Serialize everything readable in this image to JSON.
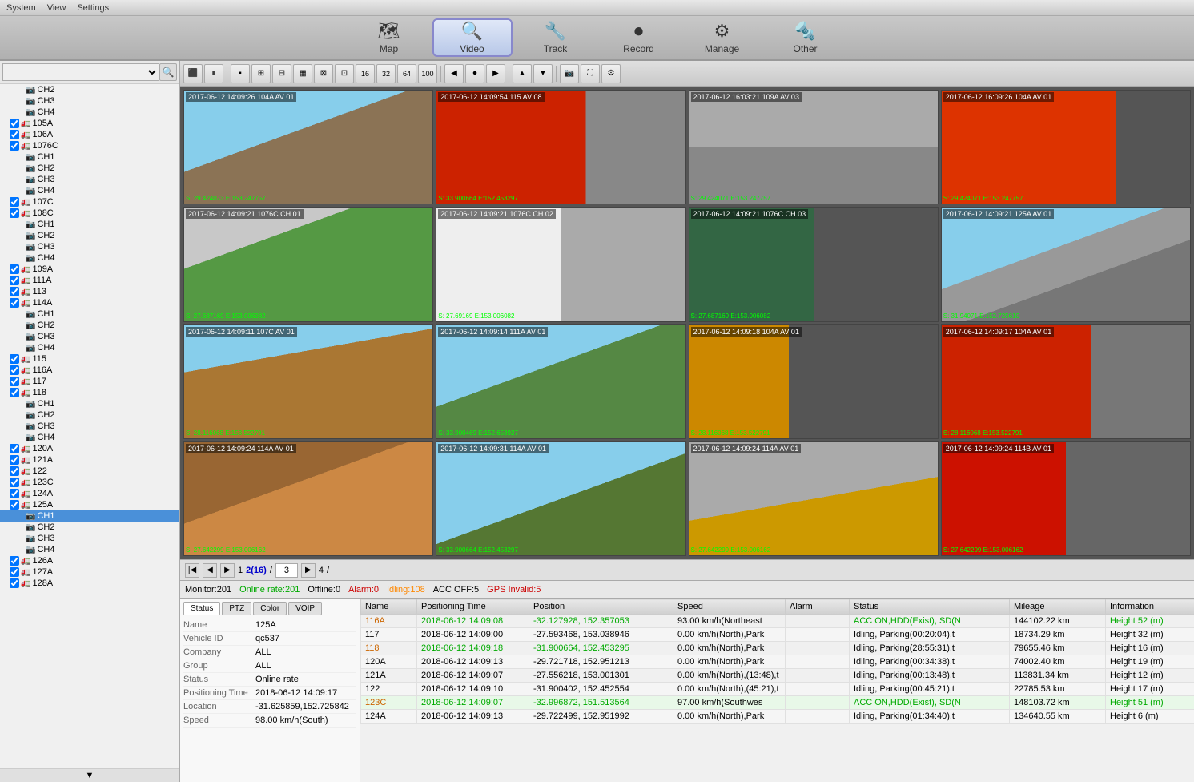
{
  "menubar": {
    "items": [
      "System",
      "View",
      "Settings"
    ]
  },
  "navtabs": [
    {
      "id": "map",
      "label": "Map",
      "icon": "🗺"
    },
    {
      "id": "video",
      "label": "Video",
      "icon": "🔍",
      "active": true
    },
    {
      "id": "track",
      "label": "Track",
      "icon": "⚙"
    },
    {
      "id": "record",
      "label": "Record",
      "icon": "⚙"
    },
    {
      "id": "manage",
      "label": "Manage",
      "icon": "⚙"
    },
    {
      "id": "other",
      "label": "Other",
      "icon": "⚙"
    }
  ],
  "sidebar": {
    "search_placeholder": "",
    "tree_items": [
      {
        "id": "ch2",
        "label": "CH2",
        "indent": 3,
        "type": "channel"
      },
      {
        "id": "ch3",
        "label": "CH3",
        "indent": 3,
        "type": "channel"
      },
      {
        "id": "ch4",
        "label": "CH4",
        "indent": 3,
        "type": "channel"
      },
      {
        "id": "105a",
        "label": "105A",
        "indent": 1,
        "type": "vehicle",
        "checked": true
      },
      {
        "id": "106a",
        "label": "106A",
        "indent": 1,
        "type": "vehicle",
        "checked": true
      },
      {
        "id": "1076c",
        "label": "1076C",
        "indent": 1,
        "type": "vehicle",
        "checked": true
      },
      {
        "id": "1076c-ch1",
        "label": "CH1",
        "indent": 3,
        "type": "channel"
      },
      {
        "id": "1076c-ch2",
        "label": "CH2",
        "indent": 3,
        "type": "channel"
      },
      {
        "id": "1076c-ch3",
        "label": "CH3",
        "indent": 3,
        "type": "channel"
      },
      {
        "id": "1076c-ch4",
        "label": "CH4",
        "indent": 3,
        "type": "channel"
      },
      {
        "id": "107c",
        "label": "107C",
        "indent": 1,
        "type": "vehicle",
        "checked": true
      },
      {
        "id": "108c",
        "label": "108C",
        "indent": 1,
        "type": "vehicle",
        "checked": true
      },
      {
        "id": "108c-ch1",
        "label": "CH1",
        "indent": 3,
        "type": "channel"
      },
      {
        "id": "108c-ch2",
        "label": "CH2",
        "indent": 3,
        "type": "channel"
      },
      {
        "id": "108c-ch3",
        "label": "CH3",
        "indent": 3,
        "type": "channel"
      },
      {
        "id": "108c-ch4",
        "label": "CH4",
        "indent": 3,
        "type": "channel"
      },
      {
        "id": "109a",
        "label": "109A",
        "indent": 1,
        "type": "vehicle",
        "checked": true
      },
      {
        "id": "111a",
        "label": "111A",
        "indent": 1,
        "type": "vehicle",
        "checked": true
      },
      {
        "id": "113",
        "label": "113",
        "indent": 1,
        "type": "vehicle",
        "checked": true
      },
      {
        "id": "114a",
        "label": "114A",
        "indent": 1,
        "type": "vehicle",
        "checked": true
      },
      {
        "id": "114a-ch1",
        "label": "CH1",
        "indent": 3,
        "type": "channel"
      },
      {
        "id": "114a-ch2",
        "label": "CH2",
        "indent": 3,
        "type": "channel"
      },
      {
        "id": "114a-ch3",
        "label": "CH3",
        "indent": 3,
        "type": "channel"
      },
      {
        "id": "114a-ch4",
        "label": "CH4",
        "indent": 3,
        "type": "channel"
      },
      {
        "id": "115",
        "label": "115",
        "indent": 1,
        "type": "vehicle",
        "checked": true
      },
      {
        "id": "116a",
        "label": "116A",
        "indent": 1,
        "type": "vehicle",
        "checked": true
      },
      {
        "id": "117",
        "label": "117",
        "indent": 1,
        "type": "vehicle",
        "checked": true
      },
      {
        "id": "118",
        "label": "118",
        "indent": 1,
        "type": "vehicle",
        "checked": true
      },
      {
        "id": "118-ch1",
        "label": "CH1",
        "indent": 3,
        "type": "channel"
      },
      {
        "id": "118-ch2",
        "label": "CH2",
        "indent": 3,
        "type": "channel"
      },
      {
        "id": "118-ch3",
        "label": "CH3",
        "indent": 3,
        "type": "channel"
      },
      {
        "id": "118-ch4",
        "label": "CH4",
        "indent": 3,
        "type": "channel"
      },
      {
        "id": "120a",
        "label": "120A",
        "indent": 1,
        "type": "vehicle",
        "checked": true
      },
      {
        "id": "121a",
        "label": "121A",
        "indent": 1,
        "type": "vehicle",
        "checked": true
      },
      {
        "id": "122",
        "label": "122",
        "indent": 1,
        "type": "vehicle",
        "checked": true
      },
      {
        "id": "123c",
        "label": "123C",
        "indent": 1,
        "type": "vehicle",
        "checked": true
      },
      {
        "id": "124a",
        "label": "124A",
        "indent": 1,
        "type": "vehicle",
        "checked": true
      },
      {
        "id": "125a",
        "label": "125A",
        "indent": 1,
        "type": "vehicle",
        "checked": true
      },
      {
        "id": "125a-ch1",
        "label": "CH1",
        "indent": 3,
        "type": "channel",
        "selected": true
      },
      {
        "id": "125a-ch2",
        "label": "CH2",
        "indent": 3,
        "type": "channel"
      },
      {
        "id": "125a-ch3",
        "label": "CH3",
        "indent": 3,
        "type": "channel"
      },
      {
        "id": "125a-ch4",
        "label": "CH4",
        "indent": 3,
        "type": "channel"
      },
      {
        "id": "126a",
        "label": "126A",
        "indent": 1,
        "type": "vehicle",
        "checked": true
      },
      {
        "id": "127a",
        "label": "127A",
        "indent": 1,
        "type": "vehicle",
        "checked": true
      },
      {
        "id": "128a",
        "label": "128A",
        "indent": 1,
        "type": "vehicle",
        "checked": true
      }
    ]
  },
  "toolbar": {
    "buttons": [
      "⬛",
      "⏸",
      "⊞",
      "⊟",
      "⊠",
      "⊡",
      "▦",
      "⊞",
      "16",
      "32",
      "64",
      "100",
      "◀",
      "⏺",
      "▶",
      "⏹",
      "▲",
      "▼",
      "⏺",
      "⏵",
      "⏸",
      "⏹",
      "⏺",
      "⏵"
    ]
  },
  "video_cells": [
    {
      "id": 1,
      "label": "104A AV 01",
      "timestamp": "2017-06-12 14:09:26",
      "coords": "S: 29.424073 E:153.247757",
      "style": "cam-road"
    },
    {
      "id": 2,
      "label": "115 AV 08",
      "timestamp": "2017-06-12 14:09:54",
      "coords": "S: 33.900664 E:152.453297",
      "style": "cam-truck-red"
    },
    {
      "id": 3,
      "label": "109A AV 03",
      "timestamp": "2017-06-12 16:03:21",
      "coords": "S: 29.424071 E:153.247757",
      "style": "cam-grey"
    },
    {
      "id": 4,
      "label": "104A AV 01",
      "timestamp": "2017-06-12 16:09:26",
      "coords": "S: 29.424071 E:153.247757",
      "style": "cam-red-side"
    },
    {
      "id": 5,
      "label": "1076C CH 01",
      "timestamp": "2017-06-12 14:09:21",
      "coords": "S: 27.687169 E:153.006082",
      "style": "cam-parking"
    },
    {
      "id": 6,
      "label": "1076C CH 02",
      "timestamp": "2017-06-12 14:09:21",
      "coords": "S: 27.69169 E:153.006082",
      "style": "cam-white-truck"
    },
    {
      "id": 7,
      "label": "1076C CH 03",
      "timestamp": "2017-06-12 14:09:21",
      "coords": "S: 27.687169 E:153.006082",
      "style": "cam-green-truck"
    },
    {
      "id": 8,
      "label": "125A AV 01",
      "timestamp": "2017-06-12 14:09:21",
      "coords": "S: 31.94071 E:152.725610",
      "style": "cam-highway"
    },
    {
      "id": 9,
      "label": "107C AV 01",
      "timestamp": "2017-06-12 14:09:11",
      "coords": "S: 28.116068 E:153.522791",
      "style": "cam-dust"
    },
    {
      "id": 10,
      "label": "111A AV 01",
      "timestamp": "2017-06-12 14:09:14",
      "coords": "S: 33.900469 E:152.653927",
      "style": "cam-street"
    },
    {
      "id": 11,
      "label": "104A AV 01",
      "timestamp": "2017-06-12 14:09:18",
      "coords": "S: 28.116068 E:153.522791",
      "style": "cam-barrier"
    },
    {
      "id": 12,
      "label": "104A AV 01",
      "timestamp": "2017-06-12 14:09:17",
      "coords": "S: 28.116068 E:153.522791",
      "style": "cam-red2"
    },
    {
      "id": 13,
      "label": "114A AV 01",
      "timestamp": "2017-06-12 14:09:24",
      "coords": "S: 27.642299 E:153.006162",
      "style": "cam-cloudy"
    },
    {
      "id": 14,
      "label": "114A AV 01",
      "timestamp": "2017-06-12 14:09:31",
      "coords": "S: 33.900664 E:152.453297",
      "style": "cam-car"
    },
    {
      "id": 15,
      "label": "114A AV 01",
      "timestamp": "2017-06-12 14:09:24",
      "coords": "S: 27.642299 E:153.006162",
      "style": "cam-yellow"
    },
    {
      "id": 16,
      "label": "114B AV 01",
      "timestamp": "2017-06-12 14:09:24",
      "coords": "S: 27.642299 E:153.006162",
      "style": "cam-red3"
    }
  ],
  "pagination": {
    "current_page": "2",
    "total_pages": "16",
    "page_input": "3",
    "jump_page": "4"
  },
  "statusbar": {
    "monitor": "Monitor:201",
    "online": "Online rate:201",
    "offline": "Offline:0",
    "alarm": "Alarm:0",
    "idling": "Idling:108",
    "acc_off": "ACC OFF:5",
    "gps_invalid": "GPS Invalid:5"
  },
  "info_tabs": [
    "Status",
    "PTZ",
    "Color",
    "VOIP"
  ],
  "info_fields": [
    {
      "label": "Name",
      "value": "125A"
    },
    {
      "label": "Vehicle ID",
      "value": "qc537"
    },
    {
      "label": "Company",
      "value": "ALL"
    },
    {
      "label": "Group",
      "value": "ALL"
    },
    {
      "label": "Status",
      "value": "Online rate"
    },
    {
      "label": "Positioning Time",
      "value": "2018-06-12 14:09:17"
    },
    {
      "label": "Location",
      "value": "-31.625859,152.725842"
    },
    {
      "label": "Speed",
      "value": "98.00 km/h(South)"
    }
  ],
  "table": {
    "columns": [
      "Name",
      "Positioning Time",
      "Position",
      "Speed",
      "Alarm",
      "Status",
      "Mileage",
      "Information"
    ],
    "col_widths": [
      "70",
      "140",
      "180",
      "140",
      "80",
      "200",
      "120",
      "160"
    ],
    "rows": [
      {
        "name": "116A",
        "name_color": "orange",
        "time": "2018-06-12 14:09:08",
        "time_color": "green",
        "position": "-32.127928, 152.357053",
        "position_color": "green",
        "speed": "93.00 km/h(Northeast",
        "speed_color": "normal",
        "alarm": "",
        "alarm_color": "normal",
        "status": "ACC ON,HDD(Exist), SD(N",
        "status_color": "green",
        "mileage": "144102.22 km",
        "mileage_color": "normal",
        "info": "Height 52 (m)",
        "info_color": "green",
        "highlight": false
      },
      {
        "name": "117",
        "name_color": "normal",
        "time": "2018-06-12 14:09:00",
        "time_color": "normal",
        "position": "-27.593468, 153.038946",
        "position_color": "normal",
        "speed": "0.00 km/h(North),Park",
        "speed_color": "normal",
        "alarm": "",
        "alarm_color": "normal",
        "status": "Idling, Parking(00:20:04),t",
        "status_color": "normal",
        "mileage": "18734.29 km",
        "mileage_color": "normal",
        "info": "Height 32 (m)",
        "info_color": "normal",
        "highlight": false
      },
      {
        "name": "118",
        "name_color": "orange",
        "time": "2018-06-12 14:09:18",
        "time_color": "green",
        "position": "-31.900664, 152.453295",
        "position_color": "green",
        "speed": "0.00 km/h(North),Park",
        "speed_color": "normal",
        "alarm": "",
        "alarm_color": "normal",
        "status": "Idling, Parking(28:55:31),t",
        "status_color": "normal",
        "mileage": "79655.46 km",
        "mileage_color": "normal",
        "info": "Height 16 (m)",
        "info_color": "normal",
        "highlight": false
      },
      {
        "name": "120A",
        "name_color": "normal",
        "time": "2018-06-12 14:09:13",
        "time_color": "normal",
        "position": "-29.721718, 152.951213",
        "position_color": "normal",
        "speed": "0.00 km/h(North),Park",
        "speed_color": "normal",
        "alarm": "",
        "alarm_color": "normal",
        "status": "Idling, Parking(00:34:38),t",
        "status_color": "normal",
        "mileage": "74002.40 km",
        "mileage_color": "normal",
        "info": "Height 19 (m)",
        "info_color": "normal",
        "highlight": false
      },
      {
        "name": "121A",
        "name_color": "normal",
        "time": "2018-06-12 14:09:07",
        "time_color": "normal",
        "position": "-27.556218, 153.001301",
        "position_color": "normal",
        "speed": "0.00 km/h(North),(13:48),t",
        "speed_color": "normal",
        "alarm": "",
        "alarm_color": "normal",
        "status": "Idling, Parking(00:13:48),t",
        "status_color": "normal",
        "mileage": "113831.34 km",
        "mileage_color": "normal",
        "info": "Height 12 (m)",
        "info_color": "normal",
        "highlight": false
      },
      {
        "name": "122",
        "name_color": "normal",
        "time": "2018-06-12 14:09:10",
        "time_color": "normal",
        "position": "-31.900402, 152.452554",
        "position_color": "normal",
        "speed": "0.00 km/h(North),(45:21),t",
        "speed_color": "normal",
        "alarm": "",
        "alarm_color": "normal",
        "status": "Idling, Parking(00:45:21),t",
        "status_color": "normal",
        "mileage": "22785.53 km",
        "mileage_color": "normal",
        "info": "Height 17 (m)",
        "info_color": "normal",
        "highlight": false
      },
      {
        "name": "123C",
        "name_color": "orange",
        "time": "2018-06-12 14:09:07",
        "time_color": "green",
        "position": "-32.996872, 151.513564",
        "position_color": "green",
        "speed": "97.00 km/h(Southwes",
        "speed_color": "normal",
        "alarm": "",
        "alarm_color": "normal",
        "status": "ACC ON,HDD(Exist), SD(N",
        "status_color": "green",
        "mileage": "148103.72 km",
        "mileage_color": "normal",
        "info": "Height 51 (m)",
        "info_color": "green",
        "highlight": true
      },
      {
        "name": "124A",
        "name_color": "normal",
        "time": "2018-06-12 14:09:13",
        "time_color": "normal",
        "position": "-29.722499, 152.951992",
        "position_color": "normal",
        "speed": "0.00 km/h(North),Park",
        "speed_color": "normal",
        "alarm": "",
        "alarm_color": "normal",
        "status": "Idling, Parking(01:34:40),t",
        "status_color": "normal",
        "mileage": "134640.55 km",
        "mileage_color": "normal",
        "info": "Height 6 (m)",
        "info_color": "normal",
        "highlight": false
      }
    ]
  }
}
